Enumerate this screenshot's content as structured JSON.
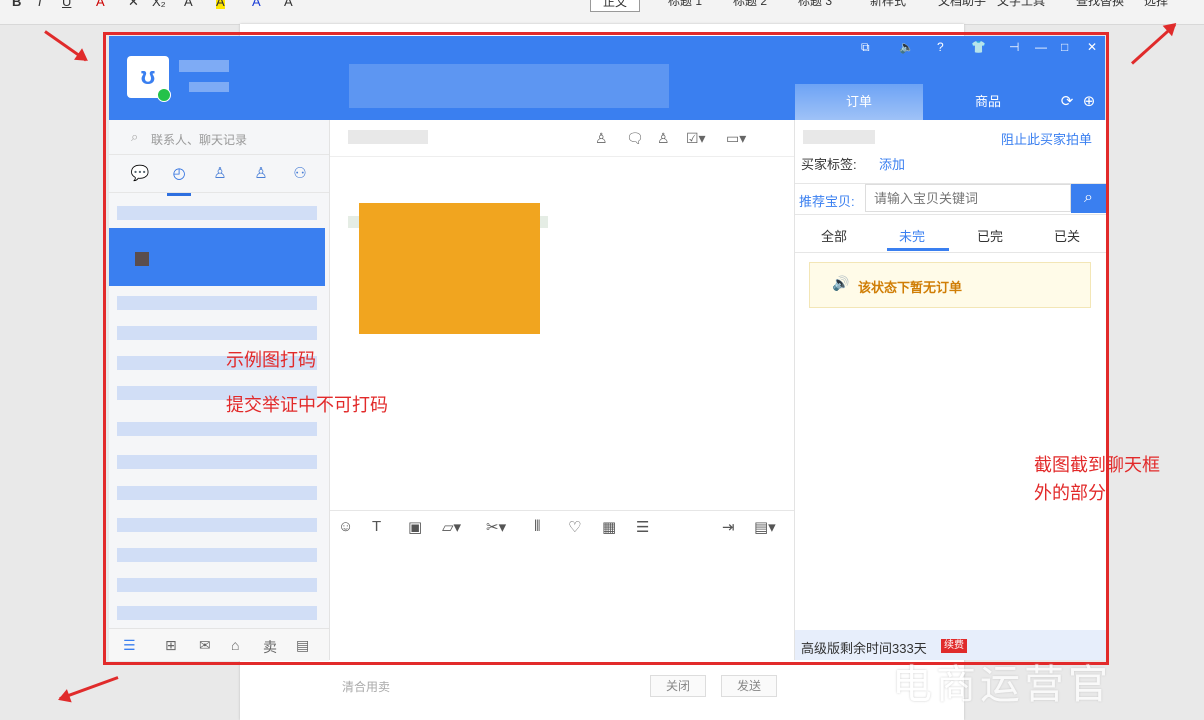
{
  "toolbar": {
    "buttons": [
      "B",
      "I",
      "U",
      "A",
      "✕",
      "X₂",
      "A",
      "A",
      "A",
      "A"
    ],
    "styles": [
      "正文",
      "标题 1",
      "标题 2",
      "标题 3"
    ],
    "new_style": "新样式",
    "doc_assistant": "文档助手",
    "text_tools": "文字工具",
    "find_replace": "查找替换",
    "select": "选择"
  },
  "window": {
    "controls": [
      "⧉",
      "🔈",
      "?",
      "👕",
      "⊣",
      "—",
      "□",
      "✕"
    ],
    "right_tabs": [
      "订单",
      "商品"
    ],
    "search_placeholder": "联系人、聊天记录",
    "block_buyer": "阻止此买家拍单",
    "buyer_tag_label": "买家标签:",
    "add_label": "添加",
    "recommend_label": "推荐宝贝:",
    "keyword_placeholder": "请输入宝贝关键词",
    "order_tabs": [
      "全部",
      "未完",
      "已完",
      "已关"
    ],
    "active_order_tab": "未完",
    "empty_message": "该状态下暂无订单",
    "footer_text": "高级版剩余时间333天",
    "footer_badge": "续费",
    "composer_hint": "清合用卖",
    "close_label": "关闭",
    "send_label": "发送"
  },
  "annotations": {
    "mask_note": "示例图打码",
    "evidence_note": "提交举证中不可打码",
    "capture_note_1": "截图截到聊天框",
    "capture_note_2": "外的部分"
  },
  "watermark": "电商运营官",
  "colors": {
    "accent": "#3a7ff0",
    "annotation": "#e22a2a",
    "image_block": "#f1a51f"
  }
}
